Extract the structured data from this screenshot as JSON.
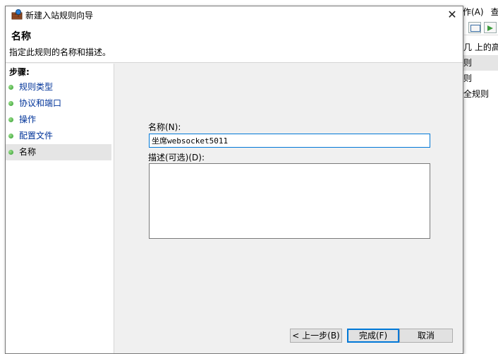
{
  "background_window": {
    "menu": [
      "作(A)",
      "查"
    ],
    "actions": [
      "几 上的高级",
      "则",
      "则",
      "全规则"
    ]
  },
  "dialog": {
    "title": "新建入站规则向导",
    "close_glyph": "✕",
    "header": {
      "title": "名称",
      "subtitle": "指定此规则的名称和描述。"
    },
    "steps_label": "步骤:",
    "steps": [
      {
        "label": "规则类型",
        "active": false
      },
      {
        "label": "协议和端口",
        "active": false
      },
      {
        "label": "操作",
        "active": false
      },
      {
        "label": "配置文件",
        "active": false
      },
      {
        "label": "名称",
        "active": true
      }
    ],
    "name_field": {
      "label": "名称(N):",
      "value": "坐席websocket5011"
    },
    "description_field": {
      "label": "描述(可选)(D):",
      "value": ""
    },
    "buttons": {
      "back": "< 上一步(B)",
      "finish": "完成(F)",
      "cancel": "取消"
    }
  },
  "colors": {
    "link": "#003399",
    "focus": "#0078d7",
    "step_dot": "#2f9b2f"
  },
  "icons": {
    "title": "firewall-icon",
    "close": "close-icon",
    "step": "green-dot-icon"
  }
}
